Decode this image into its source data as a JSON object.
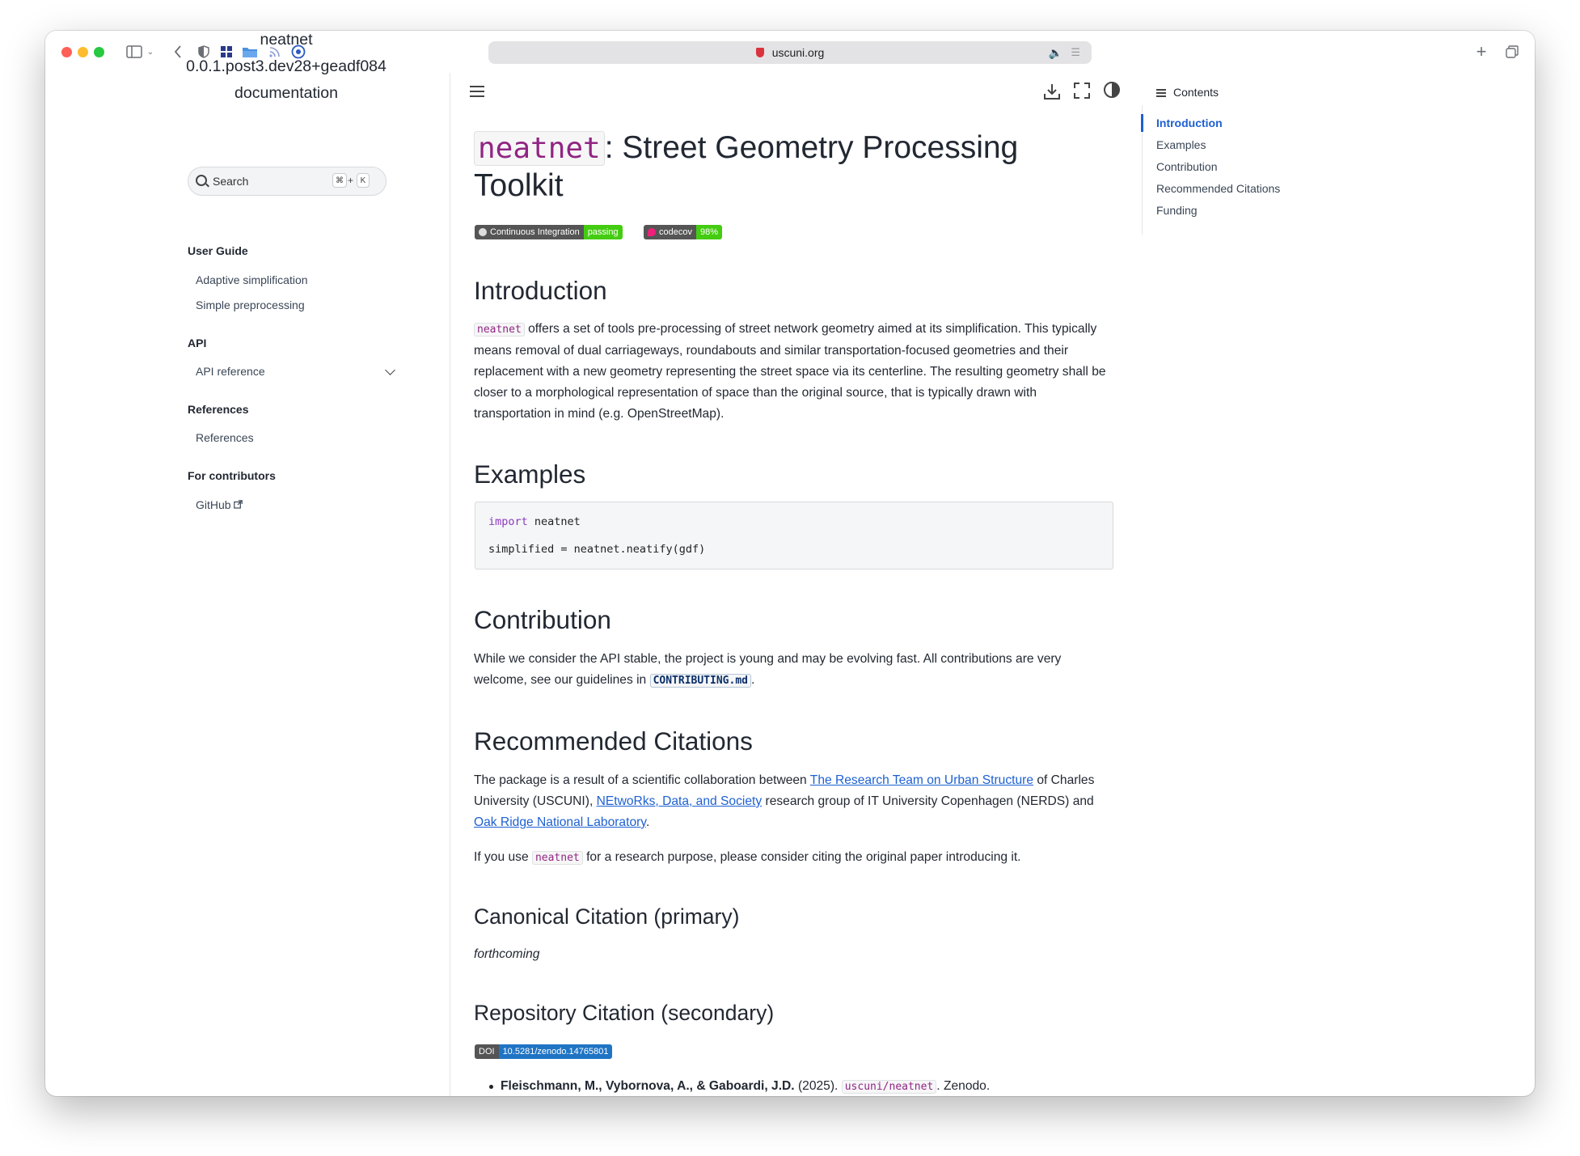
{
  "browser": {
    "url": "uscuni.org"
  },
  "sidebar": {
    "project_title": [
      "neatnet",
      "0.0.1.post3.dev28+geadf084",
      "documentation"
    ],
    "search_placeholder": "Search",
    "search_shortcut": [
      "⌘",
      "+",
      "K"
    ],
    "sections": [
      {
        "title": "User Guide",
        "links": [
          "Adaptive simplification",
          "Simple preprocessing"
        ]
      },
      {
        "title": "API",
        "links": [
          "API reference"
        ]
      },
      {
        "title": "References",
        "links": [
          "References"
        ]
      },
      {
        "title": "For contributors",
        "links": [
          "GitHub"
        ]
      }
    ]
  },
  "main": {
    "title_code": "neatnet",
    "title_rest": ": Street Geometry Processing Toolkit",
    "badges": {
      "ci_label": "Continuous Integration",
      "ci_status": "passing",
      "ci_status_color": "#4c1",
      "codecov_label": "codecov",
      "codecov_value": "98%",
      "codecov_color": "#44cc11"
    },
    "intro": {
      "heading": "Introduction",
      "code": "neatnet",
      "text": " offers a set of tools pre-processing of street network geometry aimed at its simplification. This typically means removal of dual carriageways, roundabouts and similar transportation-focused geometries and their replacement with a new geometry representing the street space via its centerline. The resulting geometry shall be closer to a morphological representation of space than the original source, that is typically drawn with transportation in mind (e.g. OpenStreetMap)."
    },
    "examples": {
      "heading": "Examples",
      "code_line1_kw": "import",
      "code_line1_rest": " neatnet",
      "code_line2": "simplified = neatnet.neatify(gdf)"
    },
    "contribution": {
      "heading": "Contribution",
      "text_before": "While we consider the API stable, the project is young and may be evolving fast. All contributions are very welcome, see our guidelines in ",
      "link_code": "CONTRIBUTING.md",
      "text_after": "."
    },
    "citations": {
      "heading": "Recommended Citations",
      "p1_a": "The package is a result of a scientific collaboration between ",
      "link1": "The Research Team on Urban Structure",
      "p1_b": " of Charles University (USCUNI), ",
      "link2": "NEtwoRks, Data, and Society",
      "p1_c": " research group of IT University Copenhagen (NERDS) and ",
      "link3": "Oak Ridge National Laboratory",
      "p1_d": ".",
      "p2_a": "If you use ",
      "p2_code": "neatnet",
      "p2_b": " for a research purpose, please consider citing the original paper introducing it.",
      "canonical_heading": "Canonical Citation (primary)",
      "canonical_text": "forthcoming",
      "repo_heading": "Repository Citation (secondary)",
      "doi_label": "DOI",
      "doi_value": "10.5281/zenodo.14765801",
      "bullet_authors": "Fleischmann, M., Vybornova, A., & Gaboardi, J.D.",
      "bullet_year": " (2025). ",
      "bullet_code": "uscuni/neatnet",
      "bullet_end": ". Zenodo."
    }
  },
  "toc": {
    "heading": "Contents",
    "items": [
      "Introduction",
      "Examples",
      "Contribution",
      "Recommended Citations",
      "Funding"
    ],
    "active": "Introduction"
  },
  "colors": {
    "accent": "#1d60d2",
    "code_purple": "#912583"
  }
}
